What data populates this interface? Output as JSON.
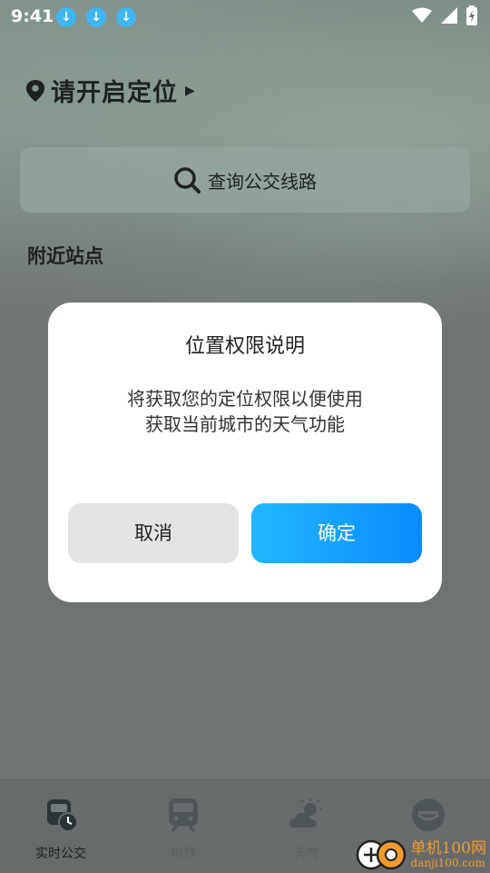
{
  "status_bar": {
    "time": "9:41",
    "download_icons": [
      "download-icon",
      "download-icon",
      "download-icon"
    ],
    "system_icons": [
      "wifi-icon",
      "signal-icon",
      "battery-charging-icon"
    ]
  },
  "header": {
    "location_text": "请开启定位",
    "search_placeholder": "查询公交线路",
    "section_title": "附近站点"
  },
  "dialog": {
    "title": "位置权限说明",
    "message_line1": "将获取您的定位权限以便使用",
    "message_line2": "获取当前城市的天气功能",
    "cancel_label": "取消",
    "confirm_label": "确定"
  },
  "bottom_nav": {
    "items": [
      {
        "label": "实时公交",
        "icon": "bus-clock-icon",
        "active": true
      },
      {
        "label": "地铁",
        "icon": "metro-icon",
        "active": false
      },
      {
        "label": "天气",
        "icon": "weather-icon",
        "active": false
      },
      {
        "label": "",
        "icon": "profile-icon",
        "active": false
      }
    ]
  },
  "watermark": {
    "text_cn": "单机100网",
    "text_url": "danji100.com"
  },
  "colors": {
    "accent": "#0a8bff",
    "accent_light": "#20b8ff",
    "overlay": "#6f7373",
    "download_badge": "#3fb6f0",
    "watermark": "#f29a2e"
  }
}
